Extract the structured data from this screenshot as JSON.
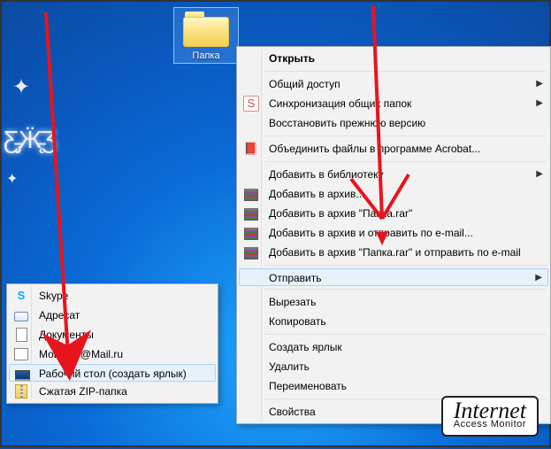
{
  "desktop": {
    "folder_label": "Папка"
  },
  "main_menu": {
    "open": "Открыть",
    "share": "Общий доступ",
    "sync": "Синхронизация общих папок",
    "restore": "Восстановить прежнюю версию",
    "acrobat": "Объединить файлы в программе Acrobat...",
    "library": "Добавить в библиотеку",
    "add_archive": "Добавить в архив...",
    "add_named": "Добавить в архив \"Папка.rar\"",
    "add_email": "Добавить в архив и отправить по e-mail...",
    "add_named_email": "Добавить в архив \"Папка.rar\" и отправить по e-mail",
    "send_to": "Отправить",
    "cut": "Вырезать",
    "copy": "Копировать",
    "shortcut": "Создать ярлык",
    "delete": "Удалить",
    "rename": "Переименовать",
    "properties": "Свойства"
  },
  "sub_menu": {
    "skype": "Skype",
    "addressee": "Адресат",
    "documents": "Документы",
    "moimir": "МойМир@Mail.ru",
    "desktop_link": "Рабочий стол (создать ярлык)",
    "zip": "Сжатая ZIP-папка"
  },
  "watermark": {
    "line1": "Internet",
    "line2": "Access Monitor"
  }
}
